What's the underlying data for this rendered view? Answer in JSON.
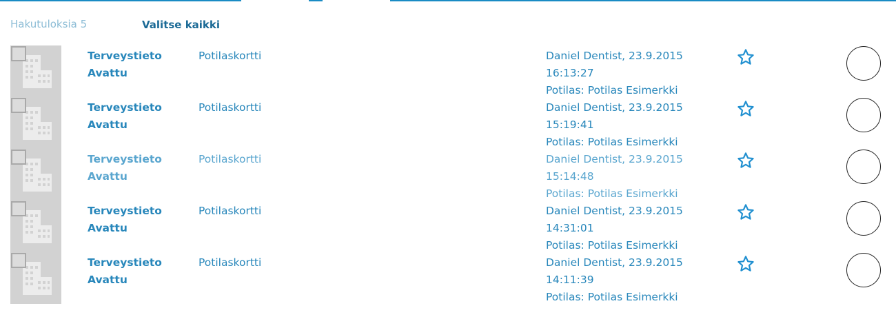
{
  "header": {
    "result_count": "Hakutuloksia 5",
    "select_all": "Valitse kaikki"
  },
  "icons": {
    "thumbnail": "building-icon",
    "checkbox": "checkbox-icon",
    "favorite": "star-outline-icon",
    "select": "circle-radio-icon"
  },
  "colors": {
    "accent": "#2887bb",
    "accent_dark": "#1b6a96",
    "muted": "#8dbdd6",
    "thumbnail_bg": "#d2d2d2"
  },
  "results": [
    {
      "type": "Terveystieto",
      "status": "Avattu",
      "document": "Potilaskortti",
      "author_date": "Daniel Dentist, 23.9.2015",
      "time": "16:13:27",
      "patient": "Potilas: Potilas Esimerkki"
    },
    {
      "type": "Terveystieto",
      "status": "Avattu",
      "document": "Potilaskortti",
      "author_date": "Daniel Dentist, 23.9.2015",
      "time": "15:19:41",
      "patient": "Potilas: Potilas Esimerkki"
    },
    {
      "type": "Terveystieto",
      "status": "Avattu",
      "document": "Potilaskortti",
      "author_date": "Daniel Dentist, 23.9.2015",
      "time": "15:14:48",
      "patient": "Potilas: Potilas Esimerkki"
    },
    {
      "type": "Terveystieto",
      "status": "Avattu",
      "document": "Potilaskortti",
      "author_date": "Daniel Dentist, 23.9.2015",
      "time": "14:31:01",
      "patient": "Potilas: Potilas Esimerkki"
    },
    {
      "type": "Terveystieto",
      "status": "Avattu",
      "document": "Potilaskortti",
      "author_date": "Daniel Dentist, 23.9.2015",
      "time": "14:11:39",
      "patient": "Potilas: Potilas Esimerkki"
    }
  ]
}
